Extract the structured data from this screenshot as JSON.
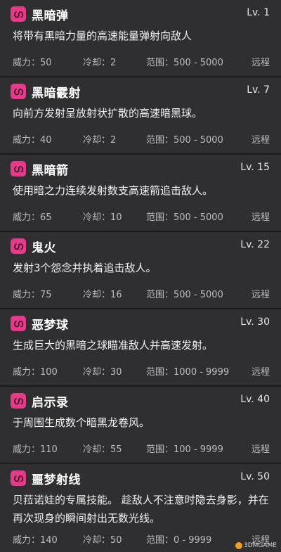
{
  "skills": [
    {
      "icon": "shadow-swirl-icon",
      "name": "黑暗弹",
      "level": "Lv. 1",
      "desc": "将带有黑暗力量的高速能量弹射向敌人",
      "power": "威力：50",
      "cooldown": "冷却：2",
      "range": "范围：500 - 5000",
      "type": "远程"
    },
    {
      "icon": "shadow-swirl-icon",
      "name": "黑暗霰射",
      "level": "Lv. 7",
      "desc": "向前方发射呈放射状扩散的高速暗黑球。",
      "power": "威力：40",
      "cooldown": "冷却：2",
      "range": "范围：500 - 5000",
      "type": "远程"
    },
    {
      "icon": "shadow-swirl-icon",
      "name": "黑暗箭",
      "level": "Lv. 15",
      "desc": "使用暗之力连续发射数支高速箭追击敌人。",
      "power": "威力：65",
      "cooldown": "冷却：10",
      "range": "范围：500 - 5000",
      "type": "远程"
    },
    {
      "icon": "shadow-swirl-icon",
      "name": "鬼火",
      "level": "Lv. 22",
      "desc": "发射3个怨念并执着追击敌人。",
      "power": "威力：75",
      "cooldown": "冷却：16",
      "range": "范围：500 - 5000",
      "type": "远程"
    },
    {
      "icon": "shadow-swirl-icon",
      "name": "恶梦球",
      "level": "Lv. 30",
      "desc": "生成巨大的黑暗之球瞄准敌人并高速发射。",
      "power": "威力：100",
      "cooldown": "冷却：30",
      "range": "范围：1000 - 9999",
      "type": "远程"
    },
    {
      "icon": "shadow-swirl-icon",
      "name": "启示录",
      "level": "Lv. 40",
      "desc": "于周围生成数个暗黑龙卷风。",
      "power": "威力：110",
      "cooldown": "冷却：55",
      "range": "范围：100 - 9999",
      "type": "远程"
    },
    {
      "icon": "shadow-swirl-icon",
      "name": "噩梦射线",
      "level": "Lv. 50",
      "desc": "贝菈诺娃的专属技能。 趁敌人不注意时隐去身影，并在再次现身的瞬间射出无数光线。",
      "power": "威力：140",
      "cooldown": "冷却：50",
      "range": "范围：0 - 9999",
      "type": "远程"
    }
  ],
  "watermark": "3DMGAME",
  "colors": {
    "accent": "#e83a8a",
    "card_bg": "#2f2f31",
    "divider": "#1b1b1b"
  }
}
